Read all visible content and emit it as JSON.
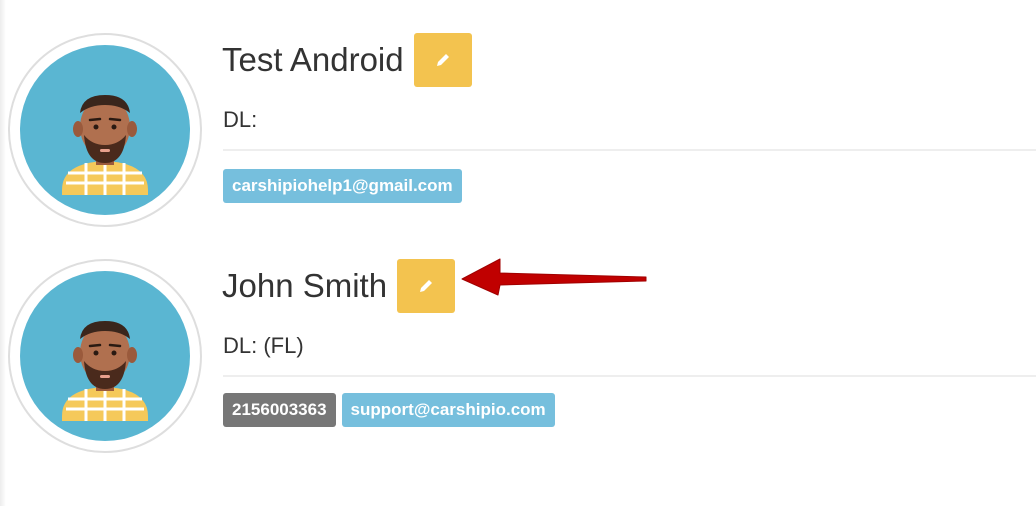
{
  "people": [
    {
      "name": "Test Android",
      "dl": "DL:",
      "phone": "",
      "email": "carshipiohelp1@gmail.com"
    },
    {
      "name": "John Smith",
      "dl": "DL: (FL)",
      "phone": "2156003363",
      "email": "support@carshipio.com"
    }
  ],
  "icons": {
    "avatar": "man-avatar-icon",
    "edit": "pencil-icon",
    "annotation": "red-arrow"
  },
  "colors": {
    "edit_button": "#f3c34f",
    "email_badge": "#76bfdd",
    "phone_badge": "#777777",
    "avatar_bg": "#5ab6d2",
    "arrow": "#c00000"
  }
}
